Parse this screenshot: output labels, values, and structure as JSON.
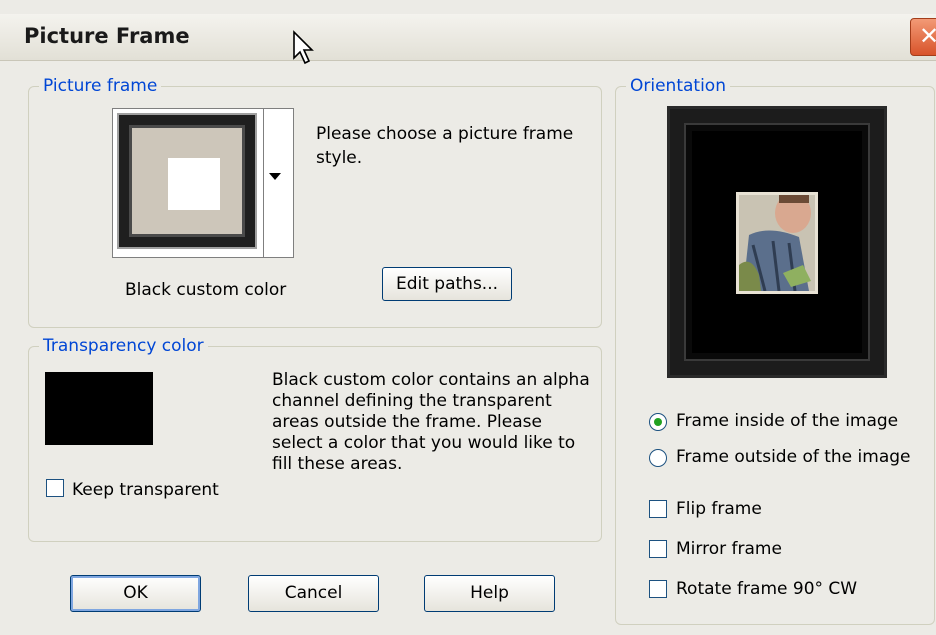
{
  "window": {
    "title": "Picture Frame",
    "close_glyph": "✕"
  },
  "picture_frame": {
    "legend": "Picture frame",
    "selected_style_caption": "Black custom color",
    "help_text": "Please choose a picture frame style.",
    "edit_paths_label": "Edit paths..."
  },
  "transparency": {
    "legend": "Transparency color",
    "swatch_color": "#000000",
    "description": "Black custom color contains an alpha channel defining the transparent areas outside the frame.  Please select a color that you would like to fill these areas.",
    "keep_transparent_label": "Keep transparent",
    "keep_transparent_checked": false
  },
  "orientation": {
    "legend": "Orientation",
    "radio_inside_label": "Frame inside of the image",
    "radio_outside_label": "Frame outside of the image",
    "selected": "inside",
    "flip_label": "Flip frame",
    "mirror_label": "Mirror frame",
    "rotate_label": "Rotate frame 90° CW",
    "flip_checked": false,
    "mirror_checked": false,
    "rotate_checked": false
  },
  "buttons": {
    "ok": "OK",
    "cancel": "Cancel",
    "help": "Help"
  },
  "colors": {
    "accent": "#0046d5",
    "radio_dot": "#21a121",
    "close": "#d8532a"
  }
}
